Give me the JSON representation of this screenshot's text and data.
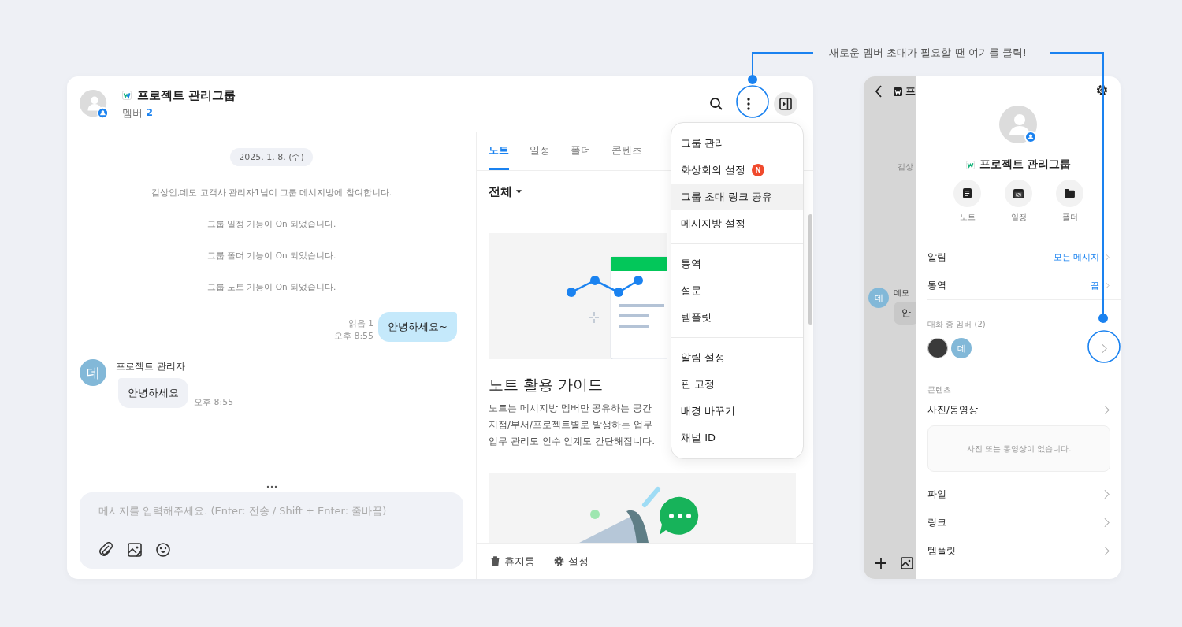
{
  "annotation": {
    "text": "새로운 멤버 초대가 필요할 땐 여기를 클릭!"
  },
  "chat_window": {
    "header": {
      "title": "프로젝트 관리그룹",
      "member_label": "멤버",
      "member_count": "2"
    },
    "messages": [
      {
        "kind": "date",
        "text": "2025. 1. 8. (수)"
      },
      {
        "kind": "system",
        "text": "김상인,데모 고객사 관리자1님이 그룹 메시지방에 참여합니다."
      },
      {
        "kind": "system",
        "text": "그룹 일정 기능이 On 되었습니다."
      },
      {
        "kind": "system",
        "text": "그룹 폴더 기능이 On 되었습니다."
      },
      {
        "kind": "system",
        "text": "그룹 노트 기능이 On 되었습니다."
      },
      {
        "kind": "outgoing",
        "text": "안녕하세요~",
        "read": "읽음 1",
        "time": "오후 8:55"
      },
      {
        "kind": "incoming",
        "sender": "프로젝트 관리자",
        "avatar": "데",
        "text": "안녕하세요",
        "time": "오후 8:55"
      }
    ],
    "composer": {
      "placeholder": "메시지를 입력해주세요. (Enter: 전송 / Shift + Enter: 줄바꿈)"
    }
  },
  "side_panel": {
    "tabs": [
      {
        "label": "노트",
        "selected": true
      },
      {
        "label": "일정",
        "selected": false
      },
      {
        "label": "폴더",
        "selected": false
      },
      {
        "label": "콘텐츠",
        "selected": false
      }
    ],
    "filter": "전체",
    "guide": {
      "title": "노트 활용 가이드",
      "lines": [
        "노트는 메시지방 멤버만 공유하는 공간",
        "지점/부서/프로젝트별로 발생하는 업무",
        "업무 관리도 인수 인계도 간단해집니다."
      ]
    },
    "footer": [
      "휴지통",
      "설정"
    ]
  },
  "menu": {
    "groups": [
      [
        {
          "label": "그룹 관리",
          "selected": false
        },
        {
          "label": "화상회의 설정",
          "badge": "N",
          "selected": false
        },
        {
          "label": "그룹 초대 링크 공유",
          "selected": true
        },
        {
          "label": "메시지방 설정",
          "selected": false
        }
      ],
      [
        {
          "label": "통역",
          "selected": false
        },
        {
          "label": "설문",
          "selected": false
        },
        {
          "label": "템플릿",
          "selected": false
        }
      ],
      [
        {
          "label": "알림 설정",
          "selected": false
        },
        {
          "label": "핀 고정",
          "selected": false
        },
        {
          "label": "배경 바꾸기",
          "selected": false
        },
        {
          "label": "채널 ID",
          "selected": false
        }
      ]
    ]
  },
  "info_window": {
    "background": {
      "title": "프",
      "system": "김상",
      "sender": "데모",
      "avatar": "데",
      "message": "안"
    },
    "title": "프로젝트 관리그룹",
    "shortcuts": [
      {
        "kind": "note",
        "label": "노트"
      },
      {
        "kind": "calendar",
        "label": "일정"
      },
      {
        "kind": "folder",
        "label": "폴더"
      }
    ],
    "settings": [
      {
        "label": "알림",
        "value": "모든 메시지"
      },
      {
        "label": "통역",
        "value": "끔"
      }
    ],
    "members_heading": "대화 중 멤버 (2)",
    "members": [
      {
        "kind": "photo"
      },
      {
        "kind": "initial",
        "initial": "데"
      }
    ],
    "contents_heading": "콘텐츠",
    "content_rows": [
      {
        "label": "사진/동영상",
        "empty_text": "사진 또는 동영상이 없습니다."
      },
      {
        "label": "파일"
      },
      {
        "label": "링크"
      },
      {
        "label": "템플릿"
      }
    ]
  }
}
